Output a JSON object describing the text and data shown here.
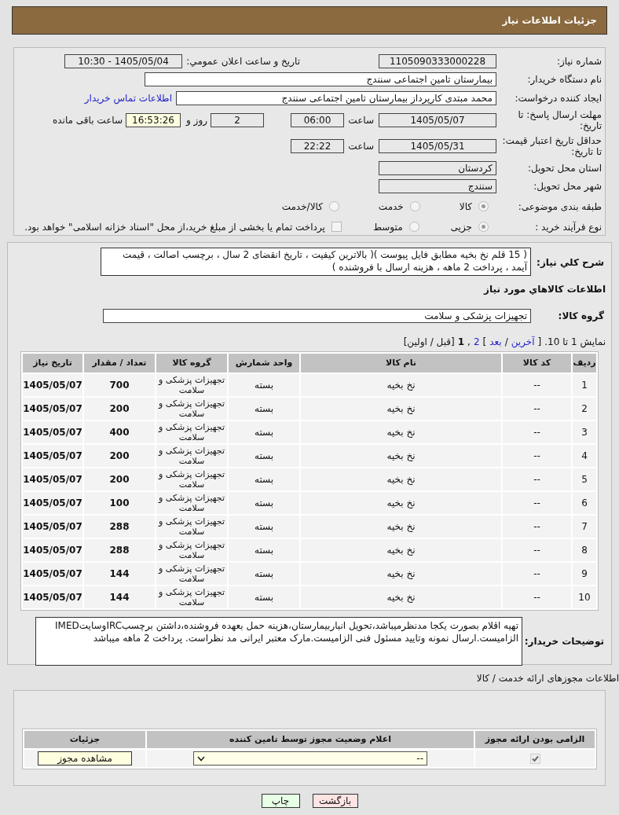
{
  "header": {
    "title": "جزئیات اطلاعات نیاز"
  },
  "details": {
    "need_number_label": "شماره نیاز:",
    "need_number": "1105090333000228",
    "announce_label": "تاریخ و ساعت اعلان عمومي:",
    "announce_value": "1405/05/04 - 10:30",
    "buyer_org_label": "نام دستگاه خریدار:",
    "buyer_org": "بیمارستان تامین اجتماعی سنندج",
    "requester_label": "ایجاد کننده درخواست:",
    "requester": "محمد مبتدی کارپرداز بیمارستان تامین اجتماعی سنندج",
    "contact_link": "اطلاعات تماس خریدار",
    "deadline_label": "مهلت ارسال پاسخ: تا تاریخ:",
    "deadline_date": "1405/05/07",
    "deadline_time_label": "ساعت",
    "deadline_time": "06:00",
    "days": "2",
    "days_label": "روز و",
    "remaining": "16:53:26",
    "remaining_label": "ساعت باقی مانده",
    "validity_label": "حداقل تاریخ اعتبار قیمت: تا تاریخ:",
    "validity_date": "1405/05/31",
    "validity_time_label": "ساعت",
    "validity_time": "22:22",
    "province_label": "استان محل تحویل:",
    "province": "کردستان",
    "city_label": "شهر محل تحویل:",
    "city": "سنندج",
    "category_label": "طبقه بندی موضوعی:",
    "category_options": [
      {
        "label": "کالا",
        "selected": true
      },
      {
        "label": "خدمت",
        "selected": false
      },
      {
        "label": "کالا/خدمت",
        "selected": false
      }
    ],
    "process_label": "نوع فرآیند خرید :",
    "process_options": [
      {
        "label": "جزیی",
        "selected": true
      },
      {
        "label": "متوسط",
        "selected": false
      }
    ],
    "treasury": {
      "label": "پرداخت تمام یا بخشی از مبلغ خرید،از محل \"اسناد خزانه اسلامی\" خواهد بود.",
      "checked": false
    }
  },
  "needs": {
    "description_label": "شرح کلي نیاز:",
    "description": "( 15 قلم نخ بخیه مطابق فایل پیوست )( بالاترین کیفیت ، تاریخ انقضای 2 سال ، برچسب اصالت ، قیمت آیمد ، پرداخت 2 ماهه ، هزینه ارسال با فروشنده )",
    "goods_title": "اطلاعات کالاهاي مورد نیاز",
    "group_label": "گروه کالا:",
    "group": "تجهیزات پزشکی و سلامت",
    "pagination": {
      "showing": "نمایش 1 تا 10.",
      "open": "[",
      "last": "آخرین",
      "sep1": "/",
      "next": "بعد",
      "close": "]",
      "page_2": "2",
      "comma": ",",
      "page_1": "1",
      "prev_first": "[قبل / اولین]"
    },
    "table": {
      "columns": [
        "ردیف",
        "کد کالا",
        "نام کالا",
        "واحد شمارش",
        "گروه کالا",
        "تعداد / مقدار",
        "تاریخ نیاز"
      ],
      "rows": [
        [
          "1",
          "--",
          "نخ بخیه",
          "بسته",
          "تجهیزات پزشکی و سلامت",
          "700",
          "1405/05/07"
        ],
        [
          "2",
          "--",
          "نخ بخیه",
          "بسته",
          "تجهیزات پزشکی و سلامت",
          "200",
          "1405/05/07"
        ],
        [
          "3",
          "--",
          "نخ بخیه",
          "بسته",
          "تجهیزات پزشکی و سلامت",
          "400",
          "1405/05/07"
        ],
        [
          "4",
          "--",
          "نخ بخیه",
          "بسته",
          "تجهیزات پزشکی و سلامت",
          "200",
          "1405/05/07"
        ],
        [
          "5",
          "--",
          "نخ بخیه",
          "بسته",
          "تجهیزات پزشکی و سلامت",
          "200",
          "1405/05/07"
        ],
        [
          "6",
          "--",
          "نخ بخیه",
          "بسته",
          "تجهیزات پزشکی و سلامت",
          "100",
          "1405/05/07"
        ],
        [
          "7",
          "--",
          "نخ بخیه",
          "بسته",
          "تجهیزات پزشکی و سلامت",
          "288",
          "1405/05/07"
        ],
        [
          "8",
          "--",
          "نخ بخیه",
          "بسته",
          "تجهیزات پزشکی و سلامت",
          "288",
          "1405/05/07"
        ],
        [
          "9",
          "--",
          "نخ بخیه",
          "بسته",
          "تجهیزات پزشکی و سلامت",
          "144",
          "1405/05/07"
        ],
        [
          "10",
          "--",
          "نخ بخیه",
          "بسته",
          "تجهیزات پزشکی و سلامت",
          "144",
          "1405/05/07"
        ]
      ]
    },
    "buyer_notes_label": "توضیحات خریدار:",
    "buyer_notes": "تهیه اقلام بصورت یکجا مدنظرمیباشد،تحویل انباربیمارستان،هزینه حمل بعهده فروشنده،داشتن برچسبIRCوسایتIMED الزامیست.ارسال نمونه وتایید مسئول فنی الزامیست.مارک معتبر ایرانی مد نظراست. پرداخت 2 ماهه میباشد"
  },
  "permits": {
    "title": "اطلاعات مجوزهای ارائه خدمت / کالا",
    "columns": [
      "الزامی بودن ارائه مجوز",
      "اعلام وضعیت مجوز توسط تامین کننده",
      "جزئیات"
    ],
    "row": {
      "required": {
        "checked": true,
        "disabled": true
      },
      "status": "--",
      "view_button": "مشاهده مجوز"
    }
  },
  "buttons": [
    {
      "kind": "back",
      "label": "بازگشت"
    },
    {
      "kind": "print",
      "label": "چاپ"
    }
  ]
}
